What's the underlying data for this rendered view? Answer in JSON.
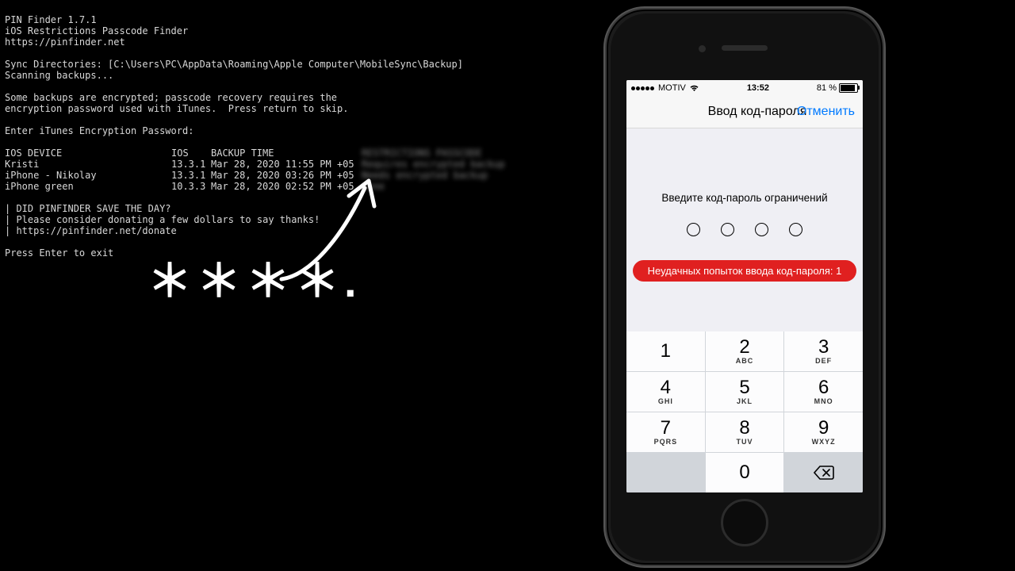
{
  "terminal": {
    "title": "PIN Finder 1.7.1",
    "subtitle": "iOS Restrictions Passcode Finder",
    "url": "https://pinfinder.net",
    "sync_line": "Sync Directories: [C:\\Users\\PC\\AppData\\Roaming\\Apple Computer\\MobileSync\\Backup]",
    "scanning": "Scanning backups...",
    "enc_line1": "Some backups are encrypted; passcode recovery requires the",
    "enc_line2": "encryption password used with iTunes.  Press return to skip.",
    "enter_pw": "Enter iTunes Encryption Password:",
    "headers": {
      "device": "IOS DEVICE",
      "ios": "IOS",
      "time": "BACKUP TIME",
      "pin": "RESTRICTIONS PASSCODE"
    },
    "rows": [
      {
        "device": "Kristi",
        "ios": "13.3.1",
        "time": "Mar 28, 2020 11:55 PM +05",
        "pin": "Requires encrypted backup"
      },
      {
        "device": "iPhone - Nikolay",
        "ios": "13.3.1",
        "time": "Mar 28, 2020 03:26 PM +05",
        "pin": "Needs encrypted backup"
      },
      {
        "device": "iPhone green",
        "ios": "10.3.3",
        "time": "Mar 28, 2020 02:52 PM +05",
        "pin": "none"
      }
    ],
    "donate1": "| DID PINFINDER SAVE THE DAY?",
    "donate2": "| Please consider donating a few dollars to say thanks!",
    "donate3": "| https://pinfinder.net/donate",
    "exit": "Press Enter to exit"
  },
  "asterisks": "＊＊＊＊.",
  "phone": {
    "status": {
      "carrier": "MOTIV",
      "time": "13:52",
      "battery_pct": "81 %"
    },
    "nav": {
      "title": "Ввод код-пароля",
      "cancel": "Отменить"
    },
    "prompt": "Введите код-пароль ограничений",
    "fail_text": "Неудачных попыток ввода код-пароля: 1",
    "keys": [
      {
        "n": "1",
        "l": " "
      },
      {
        "n": "2",
        "l": "ABC"
      },
      {
        "n": "3",
        "l": "DEF"
      },
      {
        "n": "4",
        "l": "GHI"
      },
      {
        "n": "5",
        "l": "JKL"
      },
      {
        "n": "6",
        "l": "MNO"
      },
      {
        "n": "7",
        "l": "PQRS"
      },
      {
        "n": "8",
        "l": "TUV"
      },
      {
        "n": "9",
        "l": "WXYZ"
      }
    ],
    "zero": "0"
  }
}
